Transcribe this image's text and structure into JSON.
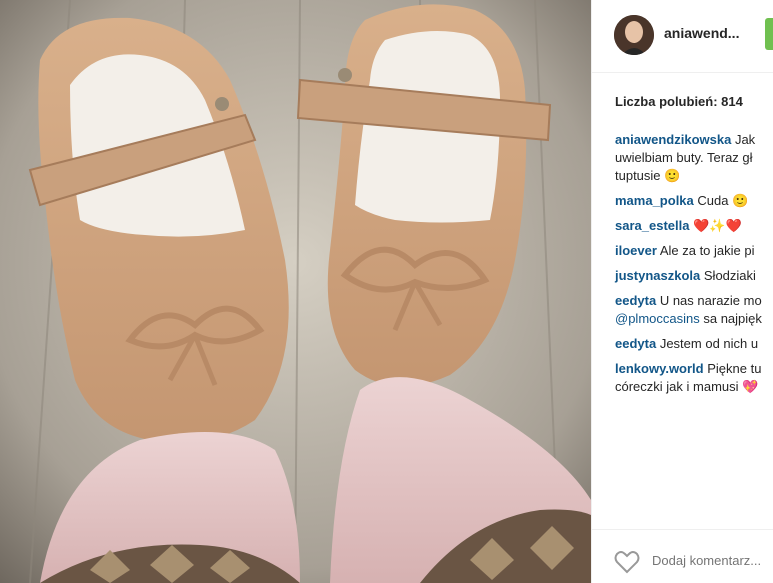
{
  "post": {
    "username": "aniawend...",
    "likes_label": "Liczba polubień: 814",
    "add_comment_placeholder": "Dodaj komentarz..."
  },
  "comments": [
    {
      "user": "aniawendzikowska",
      "lines": [
        "Jak",
        "uwielbiam buty. Teraz gł",
        "tuptusie 🙂"
      ]
    },
    {
      "user": "mama_polka",
      "lines": [
        "Cuda 🙂"
      ]
    },
    {
      "user": "sara_estella",
      "lines": [
        "❤️✨❤️"
      ]
    },
    {
      "user": "iloever",
      "lines": [
        "Ale za to jakie pi"
      ]
    },
    {
      "user": "justynaszkola",
      "lines": [
        "Słodziaki"
      ]
    },
    {
      "user": "eedyta",
      "lines": [
        "U nas narazie mo"
      ],
      "link": "@plmoccasins",
      "link_tail": "sa najpięk"
    },
    {
      "user": "eedyta",
      "lines": [
        "Jestem od nich u"
      ]
    },
    {
      "user": "lenkowy.world",
      "lines": [
        "Piękne tu",
        "córeczki jak i mamusi 💖"
      ]
    }
  ]
}
